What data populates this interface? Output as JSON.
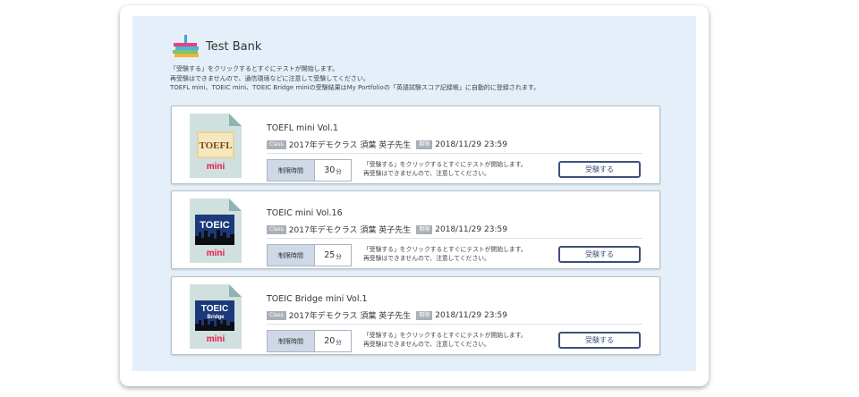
{
  "header": {
    "title": "Test Bank",
    "icon": "books-icon"
  },
  "intro": {
    "lines": [
      "「受験する」をクリックするとすぐにテストが開始します。",
      "再受験はできませんので、通信環境などに注意して受験してください。",
      "TOEFL mini、TOEIC mini、TOEIC Bridge miniの受験結果はMy Portfolioの「英語試験スコア記録帳」に自動的に登録されます。"
    ]
  },
  "labels": {
    "class_tag": "Class",
    "date_tag": "期限",
    "limit_label": "制限時間",
    "minute_unit": "分",
    "note_line1": "「受験する」をクリックするとすぐにテストが開始します。",
    "note_line2": "再受験はできませんので、注意してください。",
    "take_button": "受験する"
  },
  "tests": [
    {
      "title": "TOEFL mini Vol.1",
      "class_name": "2017年デモクラス 須葉 英子先生",
      "deadline": "2018/11/29 23:59",
      "limit": "30",
      "thumb": {
        "logo": "TOEFL",
        "sub": "",
        "badge": "mini",
        "style": "toefl"
      }
    },
    {
      "title": "TOEIC mini Vol.16",
      "class_name": "2017年デモクラス 須葉 英子先生",
      "deadline": "2018/11/29 23:59",
      "limit": "25",
      "thumb": {
        "logo": "TOEIC",
        "sub": "",
        "badge": "mini",
        "style": "toeic"
      }
    },
    {
      "title": "TOEIC Bridge mini Vol.1",
      "class_name": "2017年デモクラス 須葉 英子先生",
      "deadline": "2018/11/29 23:59",
      "limit": "20",
      "thumb": {
        "logo": "TOEIC",
        "sub": "Bridge",
        "badge": "mini",
        "style": "toeic"
      }
    }
  ],
  "colors": {
    "panel_bg": "#e4eff9",
    "button_border": "#3e4f7a",
    "badge_red": "#e8194a",
    "toeic_blue": "#1c3a7a"
  }
}
